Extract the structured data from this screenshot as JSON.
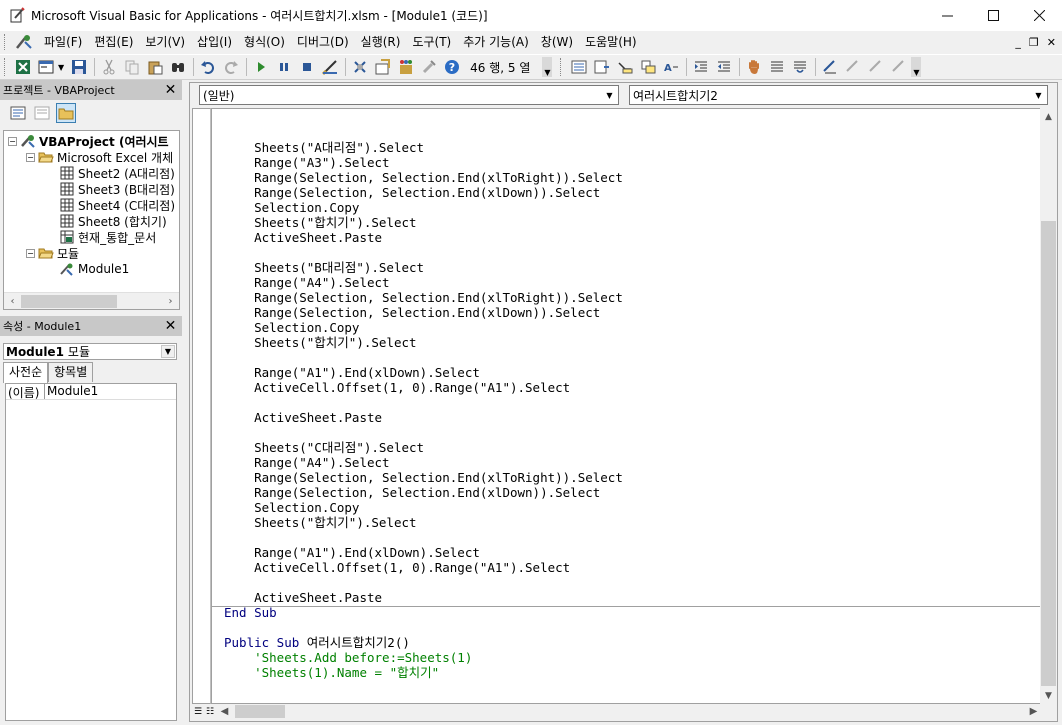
{
  "window": {
    "title": "Microsoft Visual Basic for Applications - 여러시트합치기.xlsm - [Module1 (코드)]",
    "controls": {
      "minimize": "—",
      "maximize": "☐",
      "close": "✕"
    }
  },
  "menubar": {
    "items": [
      "파일(F)",
      "편집(E)",
      "보기(V)",
      "삽입(I)",
      "형식(O)",
      "디버그(D)",
      "실행(R)",
      "도구(T)",
      "추가 기능(A)",
      "창(W)",
      "도움말(H)"
    ],
    "mdi_controls": {
      "minimize": "_",
      "restore": "❐",
      "close": "✕"
    }
  },
  "toolbar": {
    "position_text": "46 행, 5 열"
  },
  "project_panel": {
    "title": "프로젝트 - VBAProject",
    "tree": [
      {
        "label": "VBAProject (여러시트",
        "bold": true
      },
      {
        "label": "Microsoft Excel 개체"
      },
      {
        "label": "Sheet2 (A대리점)"
      },
      {
        "label": "Sheet3 (B대리점)"
      },
      {
        "label": "Sheet4 (C대리점)"
      },
      {
        "label": "Sheet8 (합치기)"
      },
      {
        "label": "현재_통합_문서"
      },
      {
        "label": "모듈"
      },
      {
        "label": "Module1"
      }
    ]
  },
  "properties_panel": {
    "title": "속성 - Module1",
    "object_name": "Module1",
    "object_type": "모듈",
    "tabs": [
      "사전순",
      "항목별"
    ],
    "rows": [
      {
        "name": "(이름)",
        "value": "Module1"
      }
    ]
  },
  "code_window": {
    "object_combo": "(일반)",
    "procedure_combo": "여러시트합치기2",
    "lines": [
      {
        "text": "",
        "kind": "code"
      },
      {
        "text": "    Sheets(\"A대리점\").Select",
        "kind": "code"
      },
      {
        "text": "    Range(\"A3\").Select",
        "kind": "code"
      },
      {
        "text": "    Range(Selection, Selection.End(xlToRight)).Select",
        "kind": "code"
      },
      {
        "text": "    Range(Selection, Selection.End(xlDown)).Select",
        "kind": "code"
      },
      {
        "text": "    Selection.Copy",
        "kind": "code"
      },
      {
        "text": "    Sheets(\"합치기\").Select",
        "kind": "code"
      },
      {
        "text": "    ActiveSheet.Paste",
        "kind": "code"
      },
      {
        "text": "",
        "kind": "code"
      },
      {
        "text": "    Sheets(\"B대리점\").Select",
        "kind": "code"
      },
      {
        "text": "    Range(\"A4\").Select",
        "kind": "code"
      },
      {
        "text": "    Range(Selection, Selection.End(xlToRight)).Select",
        "kind": "code"
      },
      {
        "text": "    Range(Selection, Selection.End(xlDown)).Select",
        "kind": "code"
      },
      {
        "text": "    Selection.Copy",
        "kind": "code"
      },
      {
        "text": "    Sheets(\"합치기\").Select",
        "kind": "code"
      },
      {
        "text": "",
        "kind": "code"
      },
      {
        "text": "    Range(\"A1\").End(xlDown).Select",
        "kind": "code"
      },
      {
        "text": "    ActiveCell.Offset(1, 0).Range(\"A1\").Select",
        "kind": "code"
      },
      {
        "text": "",
        "kind": "code"
      },
      {
        "text": "    ActiveSheet.Paste",
        "kind": "code"
      },
      {
        "text": "",
        "kind": "code"
      },
      {
        "text": "    Sheets(\"C대리점\").Select",
        "kind": "code"
      },
      {
        "text": "    Range(\"A4\").Select",
        "kind": "code"
      },
      {
        "text": "    Range(Selection, Selection.End(xlToRight)).Select",
        "kind": "code"
      },
      {
        "text": "    Range(Selection, Selection.End(xlDown)).Select",
        "kind": "code"
      },
      {
        "text": "    Selection.Copy",
        "kind": "code"
      },
      {
        "text": "    Sheets(\"합치기\").Select",
        "kind": "code"
      },
      {
        "text": "",
        "kind": "code"
      },
      {
        "text": "    Range(\"A1\").End(xlDown).Select",
        "kind": "code"
      },
      {
        "text": "    ActiveCell.Offset(1, 0).Range(\"A1\").Select",
        "kind": "code"
      },
      {
        "text": "",
        "kind": "code"
      },
      {
        "text": "    ActiveSheet.Paste",
        "kind": "code"
      },
      {
        "text": "End Sub",
        "kind": "keyword"
      },
      {
        "text": "",
        "kind": "code"
      },
      {
        "text": "Public Sub 여러시트합치기2()",
        "kind": "sub"
      },
      {
        "text": "    'Sheets.Add before:=Sheets(1)",
        "kind": "comment"
      },
      {
        "text": "    'Sheets(1).Name = \"합치기\"",
        "kind": "comment"
      }
    ]
  },
  "colors": {
    "keyword": "#00007f",
    "comment": "#008000",
    "panel_title_bg": "#c8c8c8"
  },
  "icons": [
    "vba-app-icon",
    "excel-icon",
    "insert-userform-icon",
    "save-icon",
    "cut-icon",
    "copy-icon",
    "paste-icon",
    "find-icon",
    "undo-icon",
    "redo-icon",
    "run-icon",
    "break-icon",
    "reset-icon",
    "design-mode-icon",
    "project-explorer-icon",
    "properties-icon",
    "object-browser-icon",
    "toolbox-icon",
    "help-icon"
  ]
}
